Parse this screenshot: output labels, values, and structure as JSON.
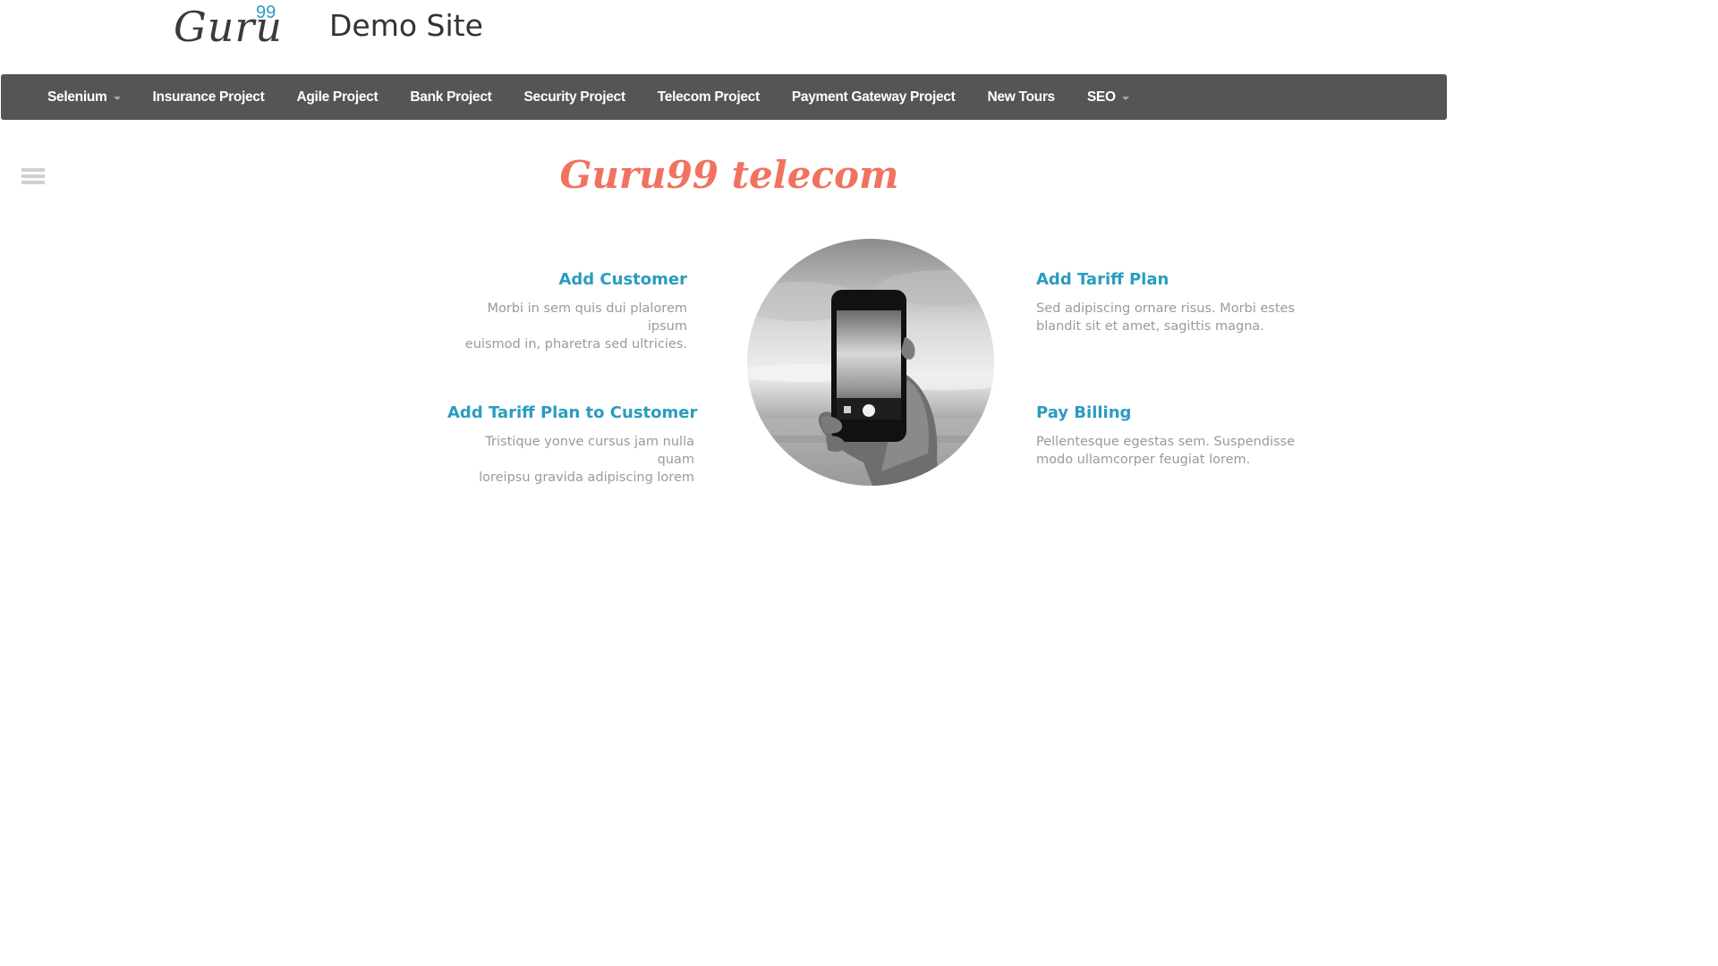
{
  "header": {
    "logo_text": "Guru",
    "logo_sup": "99",
    "site_title": "Demo Site"
  },
  "navbar": {
    "items": [
      {
        "label": "Selenium",
        "dropdown": true
      },
      {
        "label": "Insurance Project",
        "dropdown": false
      },
      {
        "label": "Agile Project",
        "dropdown": false
      },
      {
        "label": "Bank Project",
        "dropdown": false
      },
      {
        "label": "Security Project",
        "dropdown": false
      },
      {
        "label": "Telecom Project",
        "dropdown": false
      },
      {
        "label": "Payment Gateway Project",
        "dropdown": false
      },
      {
        "label": "New Tours",
        "dropdown": false
      },
      {
        "label": "SEO",
        "dropdown": true
      }
    ],
    "background": "#555555"
  },
  "main": {
    "title": "Guru99 telecom",
    "title_color": "#f0725f",
    "features": [
      {
        "title": "Add Customer",
        "desc_lines": [
          "Morbi in sem quis dui plalorem ipsum",
          "euismod in, pharetra sed ultricies."
        ]
      },
      {
        "title": "Add Tariff Plan to Customer",
        "desc_lines": [
          "Tristique yonve cursus jam nulla quam",
          "loreipsu gravida adipiscing lorem"
        ]
      },
      {
        "title": "Add Tariff Plan",
        "desc_lines": [
          "Sed adipiscing ornare risus. Morbi estes",
          "blandit sit et amet, sagittis magna."
        ]
      },
      {
        "title": "Pay Billing",
        "desc_lines": [
          "Pellentesque egestas sem. Suspendisse",
          "modo ullamcorper feugiat lorem."
        ]
      }
    ],
    "feature_title_color": "#2a9cc0",
    "photo_icon": "hand-holding-phone-image"
  },
  "icons": {
    "menu_toggle": "hamburger-menu-icon"
  }
}
